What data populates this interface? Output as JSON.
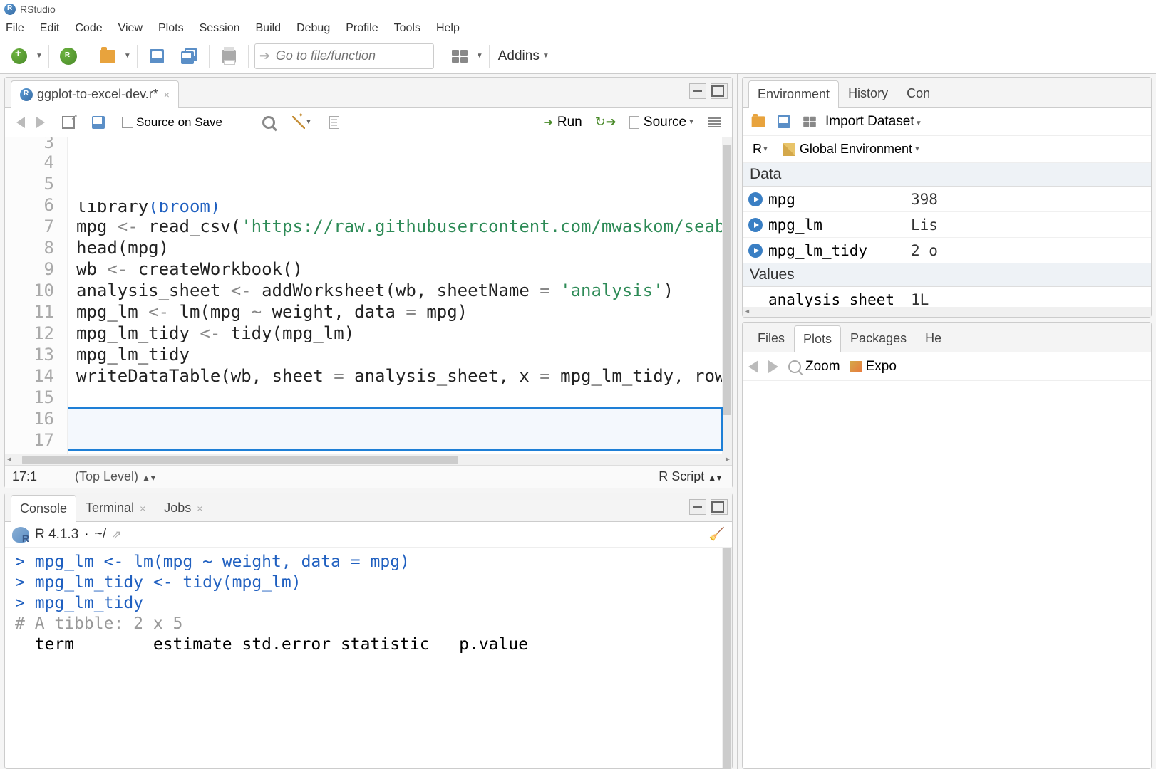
{
  "app": {
    "title": "RStudio"
  },
  "menu": [
    "File",
    "Edit",
    "Code",
    "View",
    "Plots",
    "Session",
    "Build",
    "Debug",
    "Profile",
    "Tools",
    "Help"
  ],
  "toolbar": {
    "goto_placeholder": "Go to file/function",
    "addins_label": "Addins"
  },
  "editor": {
    "tab": {
      "name": "ggplot-to-excel-dev.r*",
      "dirty": true
    },
    "source_on_save_label": "Source on Save",
    "run_label": "Run",
    "source_label": "Source",
    "first_line_no": 3,
    "lines": [
      {
        "no": 3,
        "html": "<span class='fn'>library</span>(broom)",
        "partial": true
      },
      {
        "no": 4,
        "html": ""
      },
      {
        "no": 5,
        "html": "mpg <span class='op'><-</span> <span class='fn'>read_csv</span>(<span class='str'>'https://raw.githubusercontent.com/mwaskom/seabo</span>"
      },
      {
        "no": 6,
        "html": "<span class='fn'>head</span>(mpg)"
      },
      {
        "no": 7,
        "html": ""
      },
      {
        "no": 8,
        "html": "wb <span class='op'><-</span> <span class='fn'>createWorkbook</span>()"
      },
      {
        "no": 9,
        "html": "analysis_sheet <span class='op'><-</span> <span class='fn'>addWorksheet</span>(wb, sheetName <span class='op'>=</span> <span class='str'>'analysis'</span>)"
      },
      {
        "no": 10,
        "html": ""
      },
      {
        "no": 11,
        "html": "mpg_lm <span class='op'><-</span> <span class='fn'>lm</span>(mpg <span class='op'>~</span> weight, data <span class='op'>=</span> mpg)"
      },
      {
        "no": 12,
        "html": "mpg_lm_tidy <span class='op'><-</span> <span class='fn'>tidy</span>(mpg_lm)"
      },
      {
        "no": 13,
        "html": ""
      },
      {
        "no": 14,
        "html": "mpg_lm_tidy"
      },
      {
        "no": 15,
        "html": ""
      },
      {
        "no": 16,
        "html": "<span class='fn'>writeDataTable</span>(wb, sheet <span class='op'>=</span> analysis_sheet, x <span class='op'>=</span> mpg_lm_tidy, rowN"
      },
      {
        "no": 17,
        "html": ""
      }
    ],
    "highlight_lines": [
      16,
      17
    ],
    "cursor": {
      "line": 17,
      "col": 1
    },
    "status": {
      "pos": "17:1",
      "scope": "(Top Level)",
      "lang": "R Script"
    }
  },
  "console": {
    "tabs": [
      "Console",
      "Terminal",
      "Jobs"
    ],
    "active_tab": 0,
    "header": {
      "version": "R 4.1.3",
      "dot": "·",
      "path": "~/"
    },
    "lines": [
      {
        "type": "input",
        "text": "mpg_lm <- lm(mpg ~ weight, data = mpg)"
      },
      {
        "type": "input",
        "text": "mpg_lm_tidy <- tidy(mpg_lm)"
      },
      {
        "type": "input",
        "text": "mpg_lm_tidy"
      },
      {
        "type": "comment",
        "text": "# A tibble: 2 x 5"
      },
      {
        "type": "header",
        "text": "  term        estimate std.error statistic   p.value"
      }
    ]
  },
  "env_panel": {
    "tabs": [
      "Environment",
      "History",
      "Con"
    ],
    "active_tab": 0,
    "import_label": "Import Dataset",
    "r_label": "R",
    "scope_label": "Global Environment",
    "sections": [
      {
        "title": "Data",
        "rows": [
          {
            "play": true,
            "name": "mpg",
            "value": "398"
          },
          {
            "play": true,
            "name": "mpg_lm",
            "value": "Lis"
          },
          {
            "play": true,
            "name": "mpg_lm_tidy",
            "value": "2 o"
          }
        ]
      },
      {
        "title": "Values",
        "rows": [
          {
            "play": false,
            "name": "analysis_sheet",
            "value": "1L"
          }
        ]
      }
    ]
  },
  "plots_panel": {
    "tabs": [
      "Files",
      "Plots",
      "Packages",
      "He"
    ],
    "active_tab": 1,
    "zoom_label": "Zoom",
    "export_label": "Expo"
  }
}
